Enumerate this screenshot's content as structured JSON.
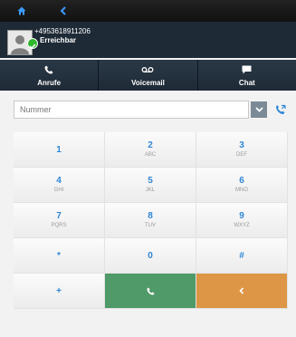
{
  "topbar": {
    "home_icon": "home-icon",
    "back_icon": "back-arrow-icon"
  },
  "profile": {
    "phone_number": "+4953618911206",
    "status": "Erreichbar",
    "status_color": "#2eb82e"
  },
  "tabs": [
    {
      "label": "Anrufe",
      "icon": "phone-icon"
    },
    {
      "label": "Voicemail",
      "icon": "voicemail-icon"
    },
    {
      "label": "Chat",
      "icon": "chat-icon"
    }
  ],
  "number_field": {
    "placeholder": "Nummer",
    "value": ""
  },
  "keypad": {
    "keys": [
      {
        "digit": "1",
        "letters": ""
      },
      {
        "digit": "2",
        "letters": "ABC"
      },
      {
        "digit": "3",
        "letters": "DEF"
      },
      {
        "digit": "4",
        "letters": "GHI"
      },
      {
        "digit": "5",
        "letters": "JKL"
      },
      {
        "digit": "6",
        "letters": "MNO"
      },
      {
        "digit": "7",
        "letters": "PQRS"
      },
      {
        "digit": "8",
        "letters": "TUV"
      },
      {
        "digit": "9",
        "letters": "WXYZ"
      },
      {
        "digit": "*",
        "letters": ""
      },
      {
        "digit": "0",
        "letters": ""
      },
      {
        "digit": "#",
        "letters": ""
      },
      {
        "digit": "+",
        "letters": ""
      }
    ]
  },
  "colors": {
    "accent": "#2f86d6",
    "call": "#4f9a68",
    "backspace": "#dc9645",
    "header": "#1e2a36"
  }
}
